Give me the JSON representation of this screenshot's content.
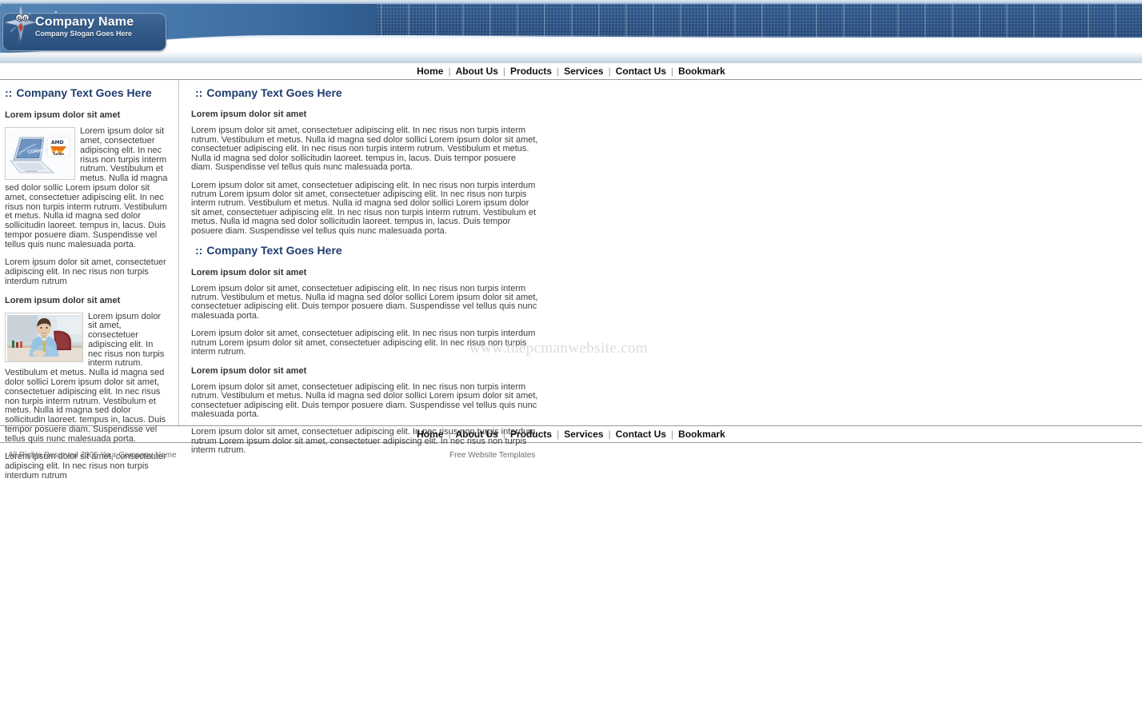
{
  "banner": {
    "company_name": "Company Name",
    "company_slogan": "Company Slogan Goes Here",
    "logo_icon": "star-compass-logo"
  },
  "nav": {
    "items": [
      {
        "label": "Home"
      },
      {
        "label": "About Us"
      },
      {
        "label": "Products"
      },
      {
        "label": "Services"
      },
      {
        "label": "Contact Us"
      },
      {
        "label": "Bookmark"
      }
    ],
    "separator": "|"
  },
  "sidebar": {
    "title": "Company Text Goes Here",
    "title_prefix": "::",
    "block1": {
      "heading": "Lorem ipsum dolor sit amet",
      "image_alt": "laptop-computer-amd-turion",
      "wrap_text": "Lorem ipsum dolor sit amet, consectetuer adipiscing elit. In nec risus non turpis interm rutrum. Vestibulum et metus. Nulla id magna sed dolor sollic Lorem ipsum dolor sit amet, consectetuer adipiscing elit. In nec risus non turpis interm rutrum. Vestibulum et metus. Nulla id magna sed dolor sollicitudin laoreet. tempus in, lacus. Duis tempor posuere diam. Suspendisse vel tellus quis nunc malesuada porta.",
      "tail_text": "Lorem ipsum dolor sit amet, consectetuer adipiscing elit. In nec risus non turpis interdum rutrum"
    },
    "block2": {
      "heading": "Lorem ipsum dolor sit amet",
      "image_alt": "businessman-at-desk-photo",
      "wrap_text": "Lorem ipsum dolor sit amet, consectetuer adipiscing elit. In nec risus non turpis interm rutrum. Vestibulum et metus. Nulla id magna sed dolor sollici Lorem ipsum dolor sit amet, consectetuer adipiscing elit. In nec risus non turpis interm rutrum. Vestibulum et metus. Nulla id magna sed dolor sollicitudin laoreet. tempus in, lacus. Duis tempor posuere diam. Suspendisse vel tellus quis nunc malesuada porta.",
      "tail_text": "Lorem ipsum dolor sit amet, consectetuer adipiscing elit. In nec risus non turpis interdum rutrum"
    }
  },
  "main": {
    "section1": {
      "title": "Company Text Goes Here",
      "title_prefix": "::",
      "heading": "Lorem ipsum dolor sit amet",
      "para1": "Lorem ipsum dolor sit amet, consectetuer adipiscing elit. In nec risus non turpis interm rutrum. Vestibulum et metus. Nulla id magna sed dolor sollici Lorem ipsum dolor sit amet, consectetuer adipiscing elit. In nec risus non turpis interm rutrum. Vestibulum et metus. Nulla id magna sed dolor sollicitudin laoreet. tempus in, lacus. Duis tempor posuere diam. Suspendisse vel tellus quis nunc malesuada porta.",
      "para2": "Lorem ipsum dolor sit amet, consectetuer adipiscing elit. In nec risus non turpis interdum rutrum Lorem ipsum dolor sit amet, consectetuer adipiscing elit. In nec risus non turpis interm rutrum. Vestibulum et metus. Nulla id magna sed dolor sollici Lorem ipsum dolor sit amet, consectetuer adipiscing elit. In nec risus non turpis interm rutrum. Vestibulum et metus. Nulla id magna sed dolor sollicitudin laoreet. tempus in, lacus. Duis tempor posuere diam. Suspendisse vel tellus quis nunc malesuada porta."
    },
    "section2": {
      "title": "Company Text Goes Here",
      "title_prefix": "::",
      "heading1": "Lorem ipsum dolor sit amet",
      "para1": "Lorem ipsum dolor sit amet, consectetuer adipiscing elit. In nec risus non turpis interm rutrum. Vestibulum et metus. Nulla id magna sed dolor sollici Lorem ipsum dolor sit amet, consectetuer adipiscing elit. Duis tempor posuere diam. Suspendisse vel tellus quis nunc malesuada porta.",
      "para2": "Lorem ipsum dolor sit amet, consectetuer adipiscing elit. In nec risus non turpis interdum rutrum Lorem ipsum dolor sit amet, consectetuer adipiscing elit. In nec risus non turpis interm rutrum.",
      "heading2": "Lorem ipsum dolor sit amet",
      "para3": "Lorem ipsum dolor sit amet, consectetuer adipiscing elit. In nec risus non turpis interm rutrum. Vestibulum et metus. Nulla id magna sed dolor sollici Lorem ipsum dolor sit amet, consectetuer adipiscing elit. Duis tempor posuere diam. Suspendisse vel tellus quis nunc malesuada porta.",
      "para4": "Lorem ipsum dolor sit amet, consectetuer adipiscing elit. In nec risus non turpis interdum rutrum Lorem ipsum dolor sit amet, consectetuer adipiscing elit. In nec risus non turpis interm rutrum."
    },
    "watermark": "www.thepcmanwebsite.com"
  },
  "footer": {
    "copyright": "All Rights Reserved 2005 Your Company Name",
    "credit": "Free Website Templates"
  },
  "colors": {
    "banner_blue": "#28537f",
    "heading_navy": "#1f3d6e",
    "body_text": "#3d3d3d",
    "footer_text": "#6e6e6e",
    "watermark": "#dcdcdc"
  }
}
